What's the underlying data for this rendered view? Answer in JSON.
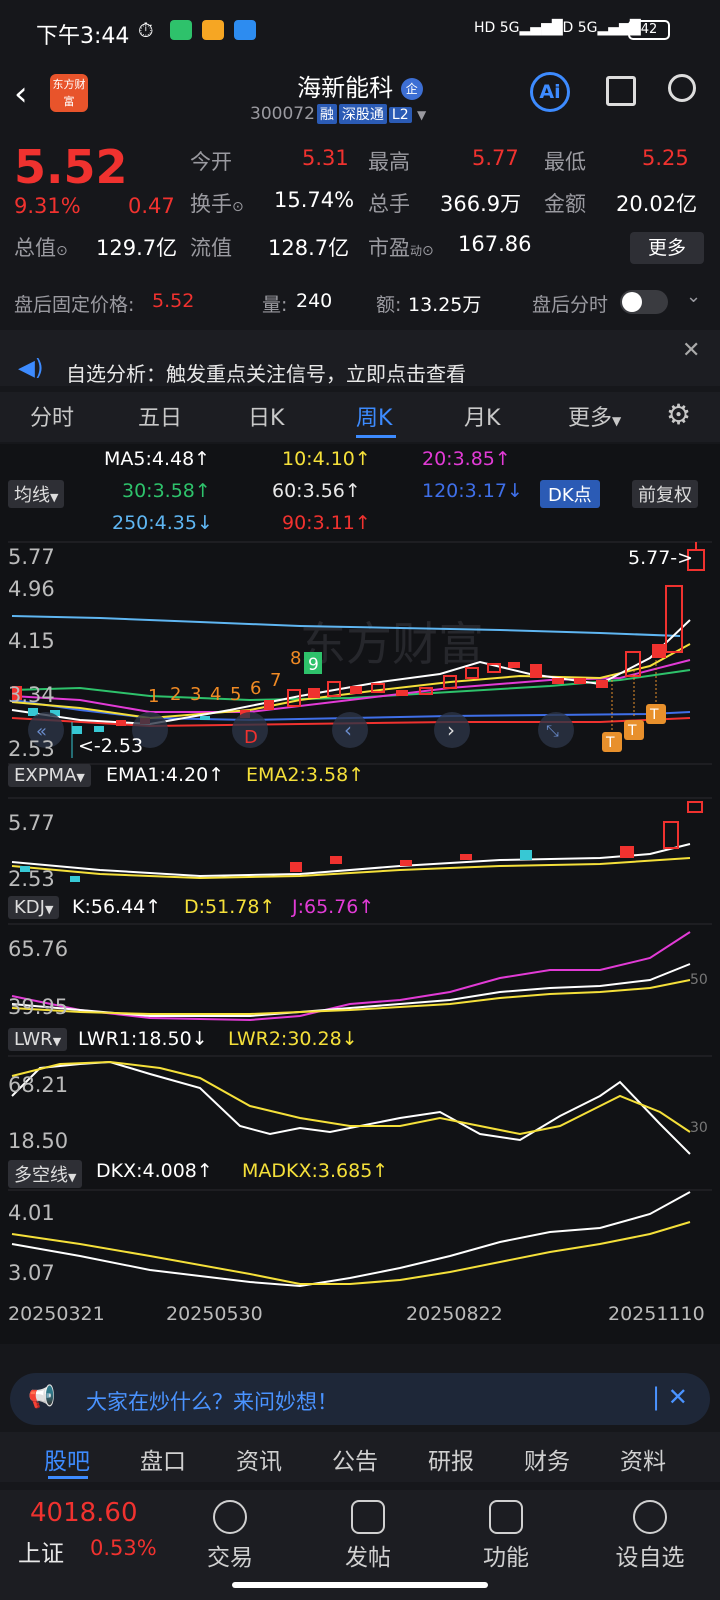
{
  "status": {
    "time": "下午3:44",
    "battery": "42",
    "network": "5G"
  },
  "header": {
    "name": "海新能科",
    "code": "300072",
    "tags": [
      "融",
      "深股通",
      "L2"
    ],
    "logo_text": "东方财富"
  },
  "quote": {
    "price": "5.52",
    "change_pct": "9.31%",
    "change": "0.47",
    "open_label": "今开",
    "open": "5.31",
    "high_label": "最高",
    "high": "5.77",
    "low_label": "最低",
    "low": "5.25",
    "turnover_label": "换手",
    "turnover": "15.74%",
    "volume_label": "总手",
    "volume": "366.9万",
    "amount_label": "金额",
    "amount": "20.02亿",
    "mktcap_label": "总值",
    "mktcap": "129.7亿",
    "float_label": "流值",
    "float": "128.7亿",
    "pe_label": "市盈",
    "pe": "167.86",
    "more": "更多"
  },
  "after_hours": {
    "label": "盘后固定价格:",
    "price": "5.52",
    "vol_label": "量:",
    "vol": "240",
    "amt_label": "额:",
    "amt": "13.25万",
    "toggle_label": "盘后分时"
  },
  "notice": {
    "text": "自选分析：触发重点关注信号，立即点击查看"
  },
  "tabs": [
    "分时",
    "五日",
    "日K",
    "周K",
    "月K",
    "更多"
  ],
  "ma": {
    "label": "均线",
    "ma5": "MA5:4.48↑",
    "ma10": "10:4.10↑",
    "ma20": "20:3.85↑",
    "ma30": "30:3.58↑",
    "ma60": "60:3.56↑",
    "ma120": "120:3.17↓",
    "ma250": "250:4.35↓",
    "ma90": "90:3.11↑",
    "dk": "DK点",
    "adjust": "前复权"
  },
  "main_chart": {
    "y_labels": [
      "5.77",
      "4.96",
      "4.15",
      "3.34",
      "2.53"
    ],
    "max_label": "5.77->",
    "min_label": "<-2.53",
    "watermark": "东方财富",
    "signals": [
      "1",
      "2",
      "3",
      "4",
      "5",
      "6",
      "7",
      "8",
      "9"
    ]
  },
  "expma": {
    "label": "EXPMA",
    "ema1": "EMA1:4.20↑",
    "ema2": "EMA2:3.58↑",
    "y_high": "5.77",
    "y_low": "2.53"
  },
  "kdj": {
    "label": "KDJ",
    "k": "K:56.44↑",
    "d": "D:51.78↑",
    "j": "J:65.76↑",
    "y_high": "65.76",
    "y_low": "39.95",
    "ref": "50"
  },
  "lwr": {
    "label": "LWR",
    "lwr1": "LWR1:18.50↓",
    "lwr2": "LWR2:30.28↓",
    "y_high": "68.21",
    "y_low": "18.50",
    "ref": "30"
  },
  "dkx": {
    "label": "多空线",
    "dkx": "DKX:4.008↑",
    "madkx": "MADKX:3.685↑",
    "y_high": "4.01",
    "y_low": "3.07"
  },
  "x_dates": [
    "20250321",
    "20250530",
    "20250822",
    "20251110"
  ],
  "ask_bar": {
    "text": "大家在炒什么？来问妙想！"
  },
  "footnav": [
    "股吧",
    "盘口",
    "资讯",
    "公告",
    "研报",
    "财务",
    "资料"
  ],
  "footer": {
    "index_value": "4018.60",
    "index_name": "上证",
    "index_pct": "0.53%",
    "buttons": [
      "交易",
      "发帖",
      "功能",
      "设自选"
    ]
  }
}
